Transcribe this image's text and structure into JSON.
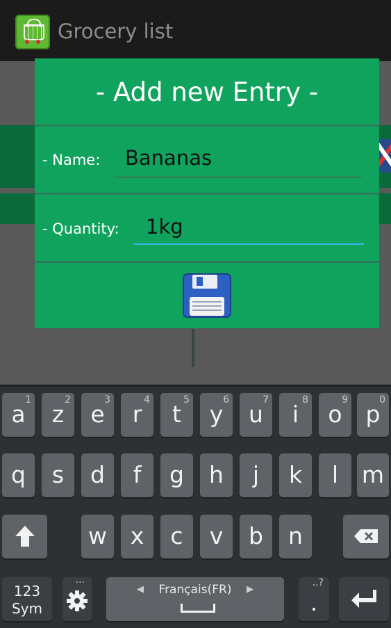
{
  "app": {
    "title": "Grocery list",
    "icon": "shopping-basket-icon"
  },
  "dialog": {
    "title": "- Add new Entry -",
    "name_label": "- Name:",
    "name_value": "Bananas",
    "quantity_label": "- Quantity:",
    "quantity_value": "1kg",
    "save_icon": "floppy-disk-icon"
  },
  "colors": {
    "dialog_bg": "#10a35d",
    "actionbar_bg": "#1b1b1b",
    "keyboard_bg": "#2e3134",
    "focus_line": "#33b5e5"
  },
  "keyboard": {
    "row1": [
      {
        "label": "a",
        "sup": "1"
      },
      {
        "label": "z",
        "sup": "2"
      },
      {
        "label": "e",
        "sup": "3"
      },
      {
        "label": "r",
        "sup": "4"
      },
      {
        "label": "t",
        "sup": "5"
      },
      {
        "label": "y",
        "sup": "6"
      },
      {
        "label": "u",
        "sup": "7"
      },
      {
        "label": "i",
        "sup": "8"
      },
      {
        "label": "o",
        "sup": "9"
      },
      {
        "label": "p",
        "sup": "0"
      }
    ],
    "row2": [
      "q",
      "s",
      "d",
      "f",
      "g",
      "h",
      "j",
      "k",
      "l",
      "m"
    ],
    "row3": [
      "w",
      "x",
      "c",
      "v",
      "b",
      "n"
    ],
    "mode_key": "123 Sym",
    "mode_key_line1": "123",
    "mode_key_line2": "Sym",
    "settings_sup": "...",
    "language": "Français(FR)",
    "period": ".",
    "period_sup": "..?",
    "shift_icon": "shift-arrow-icon",
    "backspace_icon": "backspace-icon",
    "enter_icon": "enter-icon",
    "settings_icon": "gear-icon"
  }
}
